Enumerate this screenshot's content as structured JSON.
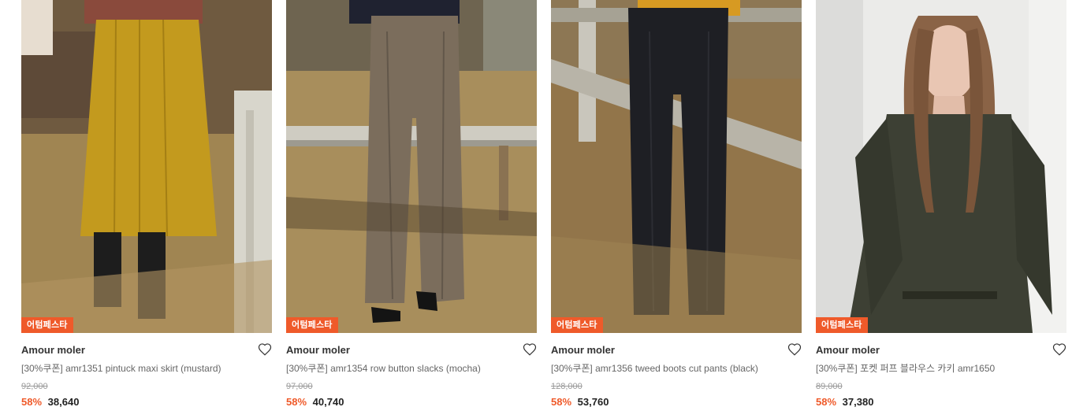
{
  "products": [
    {
      "badge": "어텀페스타",
      "brand": "Amour moler",
      "title": "[30%쿠폰] amr1351 pintuck maxi skirt (mustard)",
      "original_price": "92,000",
      "discount": "58%",
      "price": "38,640",
      "image_icon": "product-photo-mustard-skirt",
      "colors": {
        "garment": "#c39a1e",
        "background": "#8a6a3c"
      }
    },
    {
      "badge": "어텀페스타",
      "brand": "Amour moler",
      "title": "[30%쿠폰] amr1354 row button slacks (mocha)",
      "original_price": "97,000",
      "discount": "58%",
      "price": "40,740",
      "image_icon": "product-photo-mocha-slacks",
      "colors": {
        "garment": "#7b6d5c",
        "background": "#9d8353"
      }
    },
    {
      "badge": "어텀페스타",
      "brand": "Amour moler",
      "title": "[30%쿠폰] amr1356 tweed boots cut pants (black)",
      "original_price": "128,000",
      "discount": "58%",
      "price": "53,760",
      "image_icon": "product-photo-black-pants",
      "colors": {
        "garment": "#1e1f24",
        "background": "#8f7445"
      }
    },
    {
      "badge": "어텀페스타",
      "brand": "Amour moler",
      "title": "[30%쿠폰] 포켓 퍼프 블라우스 카키 amr1650",
      "original_price": "89,000",
      "discount": "58%",
      "price": "37,380",
      "image_icon": "product-photo-khaki-blouse",
      "colors": {
        "garment": "#3d4034",
        "background": "#e8e8e6"
      }
    }
  ],
  "accent_color": "#ef5a2a"
}
